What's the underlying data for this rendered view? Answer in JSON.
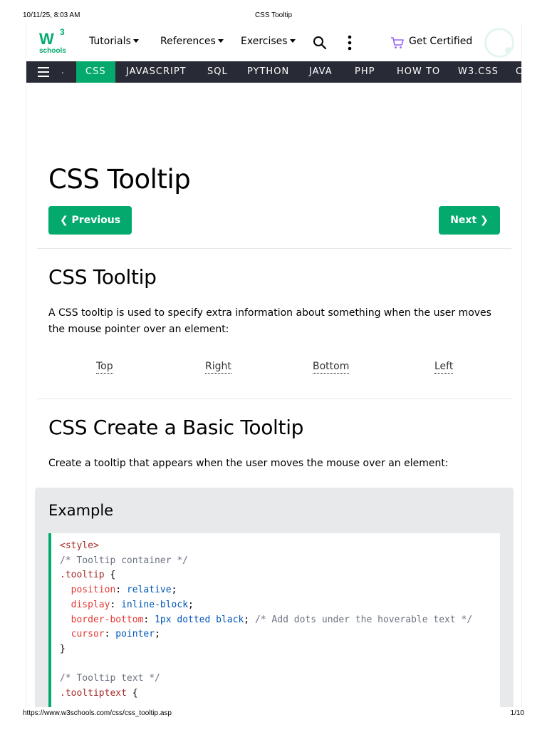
{
  "print": {
    "datetime": "10/11/25, 8:03 AM",
    "title": "CSS Tooltip",
    "url": "https://www.w3schools.com/css/css_tooltip.asp",
    "page": "1/10"
  },
  "logo": {
    "text": "W",
    "sup": "3",
    "sub": "schools"
  },
  "topnav": {
    "tutorials": "Tutorials",
    "references": "References",
    "exercises": "Exercises",
    "get_certified": "Get Certified"
  },
  "subnav": {
    "dot": ".",
    "items": [
      "CSS",
      "JAVASCRIPT",
      "SQL",
      "PYTHON",
      "JAVA",
      "PHP",
      "HOW TO",
      "W3.CSS",
      "C"
    ]
  },
  "main": {
    "title": "CSS Tooltip",
    "prev_label": "❮ Previous",
    "next_label": "Next ❯",
    "section1": {
      "heading": "CSS Tooltip",
      "text": "A CSS tooltip is used to specify extra information about something when the user moves the mouse pointer over an element:",
      "tooltips": [
        "Top",
        "Right",
        "Bottom",
        "Left"
      ]
    },
    "section2": {
      "heading": "CSS Create a Basic Tooltip",
      "text": "Create a tooltip that appears when the user moves the mouse over an element:"
    },
    "example": {
      "label": "Example",
      "code": {
        "l1": "<style>",
        "l2": "/* Tooltip container */",
        "l3_sel": ".tooltip",
        "l3_brace": " {",
        "l4_prop": "position",
        "l4_val": "relative",
        "l5_prop": "display",
        "l5_val": "inline-block",
        "l6_prop": "border-bottom",
        "l6_val": "1px dotted black",
        "l6_com": "/* Add dots under the hoverable text */",
        "l7_prop": "cursor",
        "l7_val": "pointer",
        "l8": "}",
        "l10": "/* Tooltip text */",
        "l11_sel": ".tooltiptext",
        "l11_brace": " {"
      }
    }
  },
  "colors": {
    "brand": "#04AA6D",
    "subnav_bg": "#282A35",
    "example_bg": "#E7E9EB"
  }
}
